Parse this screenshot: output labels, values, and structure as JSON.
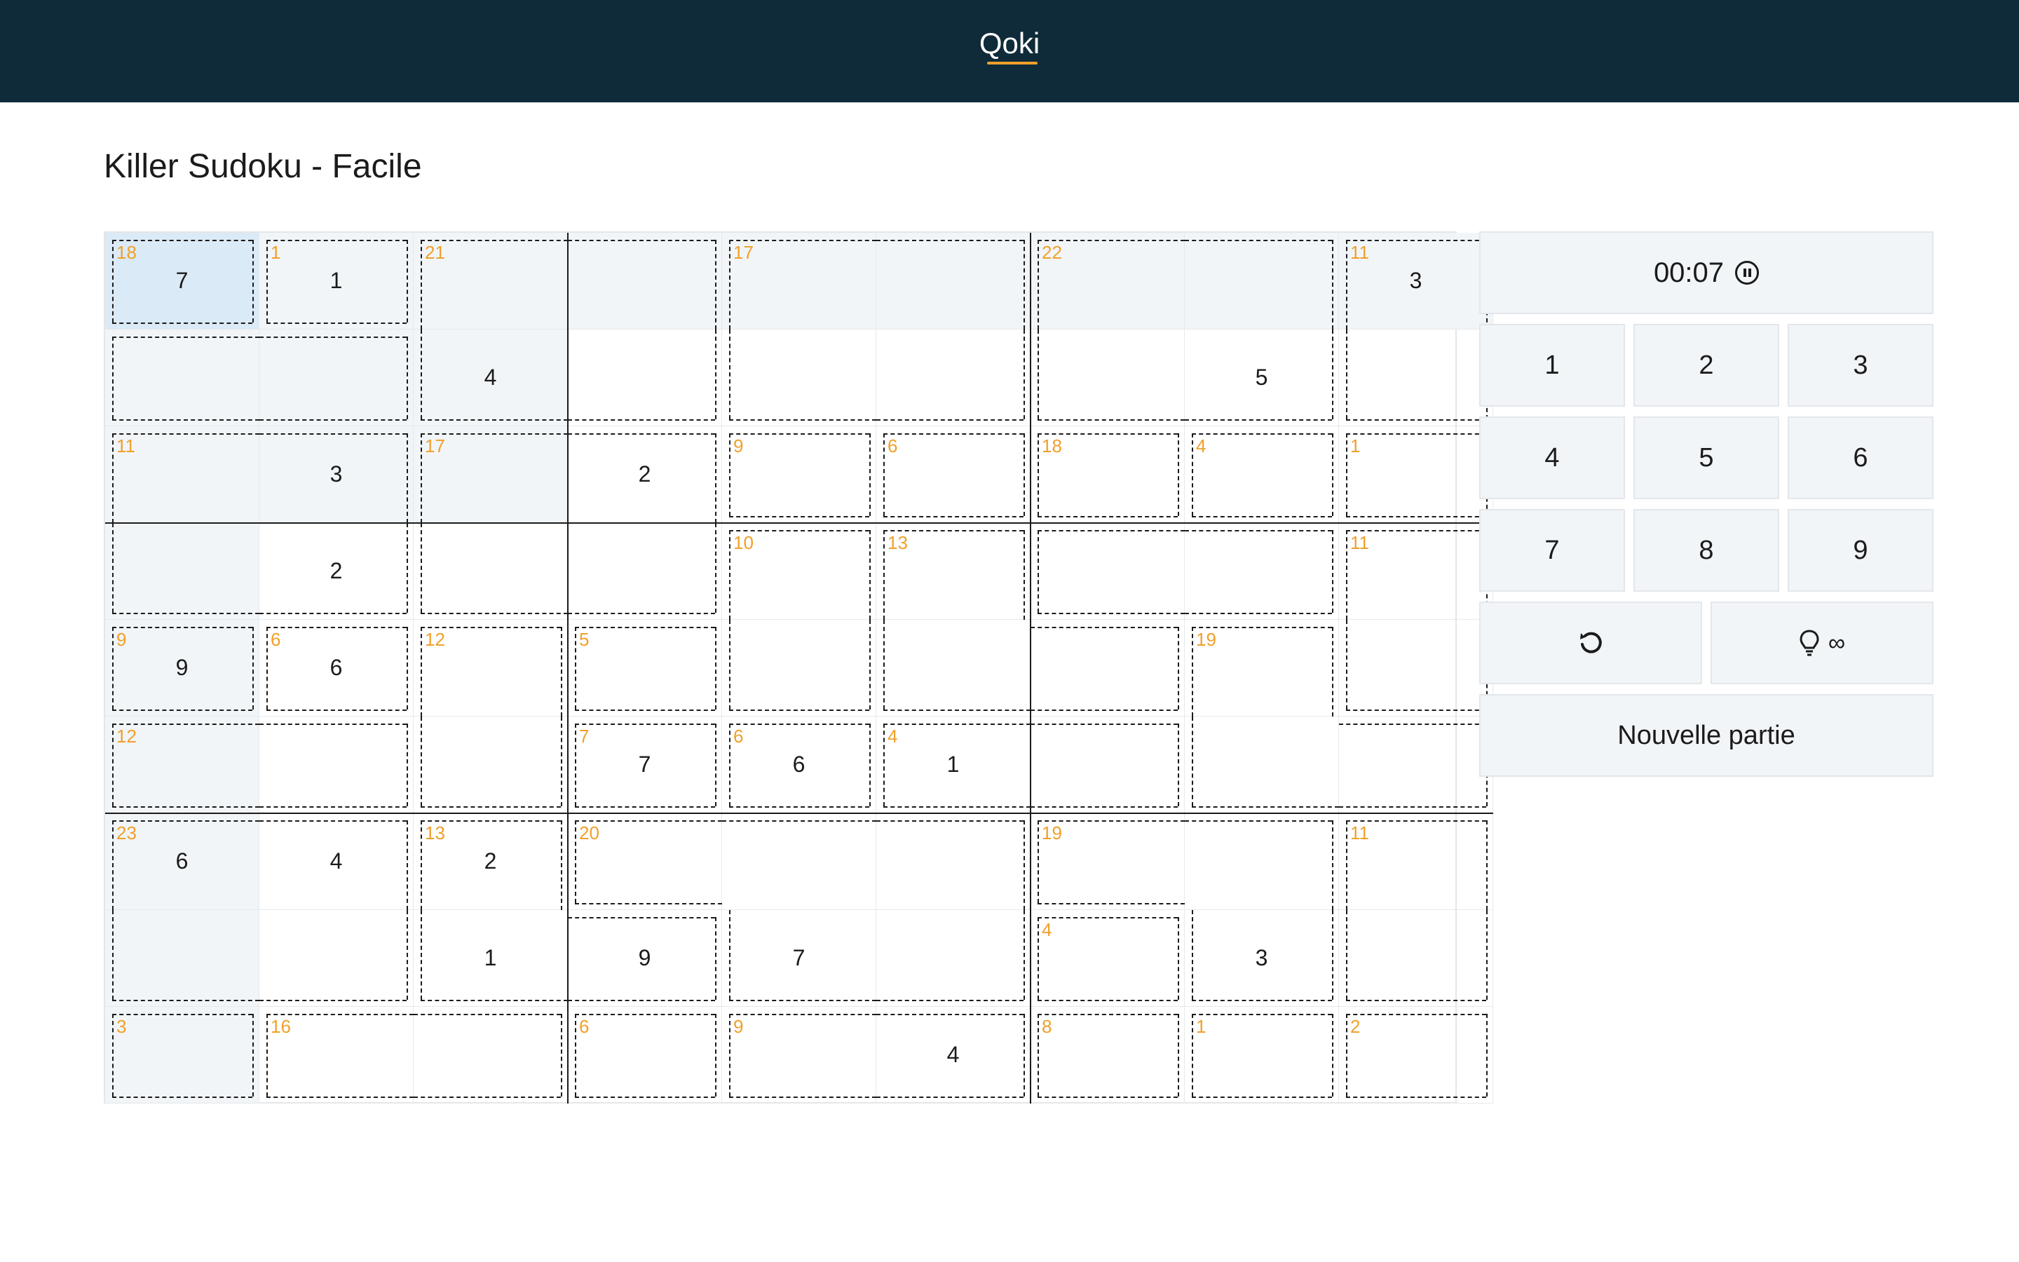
{
  "header": {
    "brand": "Qoki"
  },
  "page": {
    "title": "Killer Sudoku - Facile"
  },
  "controls": {
    "timer": "00:07",
    "timer_icon": "pause-circle-icon",
    "numbers": [
      "1",
      "2",
      "3",
      "4",
      "5",
      "6",
      "7",
      "8",
      "9"
    ],
    "undo_icon": "undo-icon",
    "hint_icon": "lightbulb-icon",
    "hint_count": "∞",
    "new_game": "Nouvelle partie"
  },
  "colors": {
    "header_bg": "#0f2b3a",
    "accent": "#f0a02a",
    "highlight": "#f1f5f8",
    "selected": "#dbeaf7"
  },
  "selected_cell": [
    0,
    0
  ],
  "board": {
    "values": [
      [
        "7",
        "1",
        "",
        "",
        "",
        "",
        "",
        "",
        "3"
      ],
      [
        "",
        "",
        "4",
        "",
        "",
        "",
        "",
        "5",
        ""
      ],
      [
        "",
        "3",
        "",
        "2",
        "",
        "",
        "",
        "",
        ""
      ],
      [
        "",
        "2",
        "",
        "",
        "",
        "",
        "",
        "",
        ""
      ],
      [
        "9",
        "6",
        "",
        "",
        "",
        "",
        "",
        "",
        ""
      ],
      [
        "",
        "",
        "",
        "7",
        "6",
        "1",
        "",
        "",
        ""
      ],
      [
        "6",
        "4",
        "2",
        "",
        "",
        "",
        "",
        "",
        ""
      ],
      [
        "",
        "",
        "1",
        "9",
        "7",
        "",
        "",
        "3",
        ""
      ],
      [
        "",
        "",
        "",
        "",
        "",
        "4",
        "",
        "",
        ""
      ]
    ],
    "highlighted": [
      [
        0,
        0
      ],
      [
        0,
        1
      ],
      [
        0,
        2
      ],
      [
        0,
        3
      ],
      [
        0,
        4
      ],
      [
        0,
        5
      ],
      [
        0,
        6
      ],
      [
        0,
        7
      ],
      [
        0,
        8
      ],
      [
        1,
        0
      ],
      [
        1,
        1
      ],
      [
        1,
        2
      ],
      [
        2,
        0
      ],
      [
        2,
        1
      ],
      [
        2,
        2
      ],
      [
        3,
        0
      ],
      [
        4,
        0
      ],
      [
        5,
        0
      ],
      [
        6,
        0
      ],
      [
        7,
        0
      ],
      [
        8,
        0
      ]
    ],
    "cages": [
      {
        "sum": "18",
        "cells": [
          [
            0,
            0
          ]
        ]
      },
      {
        "sum": "1",
        "cells": [
          [
            0,
            1
          ]
        ]
      },
      {
        "sum": "21",
        "cells": [
          [
            0,
            2
          ],
          [
            0,
            3
          ],
          [
            1,
            2
          ],
          [
            1,
            3
          ]
        ]
      },
      {
        "sum": "17",
        "cells": [
          [
            0,
            4
          ],
          [
            0,
            5
          ],
          [
            1,
            4
          ],
          [
            1,
            5
          ]
        ]
      },
      {
        "sum": "22",
        "cells": [
          [
            0,
            6
          ],
          [
            0,
            7
          ],
          [
            1,
            6
          ],
          [
            1,
            7
          ]
        ]
      },
      {
        "sum": "11",
        "cells": [
          [
            0,
            8
          ],
          [
            1,
            8
          ]
        ]
      },
      {
        "sum": "",
        "cells": [
          [
            1,
            0
          ],
          [
            1,
            1
          ]
        ]
      },
      {
        "sum": "11",
        "cells": [
          [
            2,
            0
          ],
          [
            2,
            1
          ],
          [
            3,
            0
          ],
          [
            3,
            1
          ]
        ]
      },
      {
        "sum": "17",
        "cells": [
          [
            2,
            2
          ],
          [
            2,
            3
          ],
          [
            3,
            2
          ],
          [
            3,
            3
          ]
        ]
      },
      {
        "sum": "9",
        "cells": [
          [
            2,
            4
          ]
        ]
      },
      {
        "sum": "6",
        "cells": [
          [
            2,
            5
          ]
        ]
      },
      {
        "sum": "18",
        "cells": [
          [
            2,
            6
          ]
        ]
      },
      {
        "sum": "4",
        "cells": [
          [
            2,
            7
          ]
        ]
      },
      {
        "sum": "1",
        "cells": [
          [
            2,
            8
          ]
        ]
      },
      {
        "sum": "10",
        "cells": [
          [
            3,
            4
          ],
          [
            4,
            4
          ]
        ]
      },
      {
        "sum": "13",
        "cells": [
          [
            3,
            5
          ],
          [
            4,
            5
          ],
          [
            4,
            6
          ]
        ]
      },
      {
        "sum": "",
        "cells": [
          [
            3,
            6
          ],
          [
            3,
            7
          ]
        ]
      },
      {
        "sum": "11",
        "cells": [
          [
            3,
            8
          ],
          [
            4,
            8
          ]
        ]
      },
      {
        "sum": "9",
        "cells": [
          [
            4,
            0
          ]
        ]
      },
      {
        "sum": "6",
        "cells": [
          [
            4,
            1
          ]
        ]
      },
      {
        "sum": "12",
        "cells": [
          [
            4,
            2
          ],
          [
            5,
            2
          ]
        ]
      },
      {
        "sum": "5",
        "cells": [
          [
            4,
            3
          ]
        ]
      },
      {
        "sum": "19",
        "cells": [
          [
            4,
            7
          ],
          [
            5,
            7
          ],
          [
            5,
            8
          ]
        ]
      },
      {
        "sum": "12",
        "cells": [
          [
            5,
            0
          ],
          [
            5,
            1
          ]
        ]
      },
      {
        "sum": "7",
        "cells": [
          [
            5,
            3
          ]
        ]
      },
      {
        "sum": "6",
        "cells": [
          [
            5,
            4
          ]
        ]
      },
      {
        "sum": "4",
        "cells": [
          [
            5,
            5
          ],
          [
            5,
            6
          ]
        ]
      },
      {
        "sum": "23",
        "cells": [
          [
            6,
            0
          ],
          [
            6,
            1
          ],
          [
            7,
            0
          ],
          [
            7,
            1
          ]
        ]
      },
      {
        "sum": "13",
        "cells": [
          [
            6,
            2
          ],
          [
            7,
            2
          ],
          [
            7,
            3
          ]
        ]
      },
      {
        "sum": "20",
        "cells": [
          [
            6,
            3
          ],
          [
            6,
            4
          ],
          [
            6,
            5
          ],
          [
            7,
            4
          ],
          [
            7,
            5
          ]
        ]
      },
      {
        "sum": "19",
        "cells": [
          [
            6,
            6
          ],
          [
            6,
            7
          ],
          [
            7,
            7
          ]
        ]
      },
      {
        "sum": "11",
        "cells": [
          [
            6,
            8
          ],
          [
            7,
            8
          ]
        ]
      },
      {
        "sum": "4",
        "cells": [
          [
            7,
            6
          ]
        ]
      },
      {
        "sum": "3",
        "cells": [
          [
            8,
            0
          ]
        ]
      },
      {
        "sum": "16",
        "cells": [
          [
            8,
            1
          ],
          [
            8,
            2
          ]
        ]
      },
      {
        "sum": "6",
        "cells": [
          [
            8,
            3
          ]
        ]
      },
      {
        "sum": "9",
        "cells": [
          [
            8,
            4
          ],
          [
            8,
            5
          ]
        ]
      },
      {
        "sum": "8",
        "cells": [
          [
            8,
            6
          ]
        ]
      },
      {
        "sum": "1",
        "cells": [
          [
            8,
            7
          ]
        ]
      },
      {
        "sum": "2",
        "cells": [
          [
            8,
            8
          ]
        ]
      }
    ]
  }
}
